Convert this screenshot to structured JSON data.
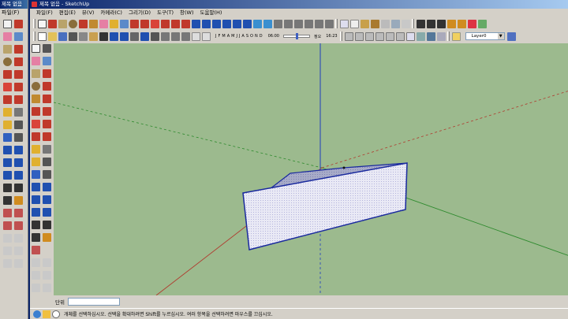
{
  "back_window": {
    "title": "제목 없음",
    "menu_label": "파일(F)"
  },
  "window": {
    "title": "제목 없음 - SketchUp"
  },
  "menu": {
    "items": [
      "파일(F)",
      "편집(E)",
      "뷰(V)",
      "카메라(C)",
      "그리기(D)",
      "도구(T)",
      "창(W)",
      "도움말(H)"
    ]
  },
  "shadow_settings": {
    "months": [
      "J",
      "F",
      "M",
      "A",
      "M",
      "J",
      "J",
      "A",
      "S",
      "O",
      "N",
      "D"
    ],
    "sunrise_time": "06:00",
    "noon_label": "정오",
    "sunset_time": "16:23"
  },
  "layers": {
    "current_layer": "Layer0",
    "dropdown_arrow": "▼"
  },
  "measurements": {
    "label": "단위",
    "value": ""
  },
  "status": {
    "message": "개체를 선택하십시오. 선택을 확대하려면 Shift를 누르십시오. 여러 항목을 선택하려면 마우스를 끄십시오."
  },
  "colors": {
    "viewport_background": "#9cba8e",
    "title_bar": "#0a246a",
    "axis_red": "#b03a2e",
    "axis_green": "#2d8a2d",
    "axis_blue": "#1f3fbf",
    "model_face": "#e8e8f4",
    "model_edge": "#1a2a9e"
  }
}
